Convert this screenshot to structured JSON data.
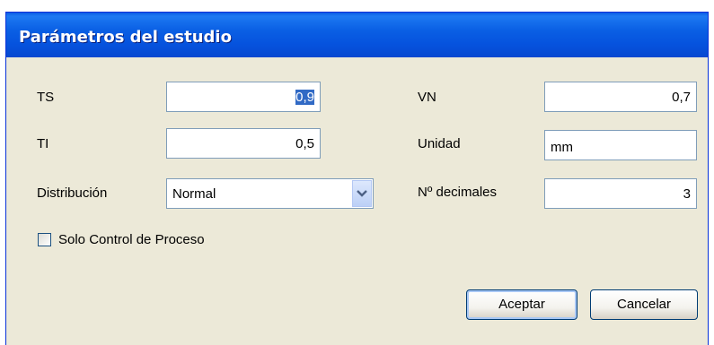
{
  "dialog": {
    "title": "Parámetros del estudio"
  },
  "fields": {
    "ts": {
      "label": "TS",
      "value": "0,9"
    },
    "ti": {
      "label": "TI",
      "value": "0,5"
    },
    "distribucion": {
      "label": "Distribución",
      "value": "Normal"
    },
    "vn": {
      "label": "VN",
      "value": "0,7"
    },
    "unidad": {
      "label": "Unidad",
      "value": "mm"
    },
    "decimales": {
      "label": "Nº decimales",
      "value": "3"
    }
  },
  "checkbox": {
    "label": "Solo Control de Proceso",
    "checked": false
  },
  "buttons": {
    "accept": "Aceptar",
    "cancel": "Cancelar"
  },
  "colors": {
    "titlebar": "#0a5fe4",
    "dialog_bg": "#ece9d8",
    "selection": "#316ac5"
  }
}
